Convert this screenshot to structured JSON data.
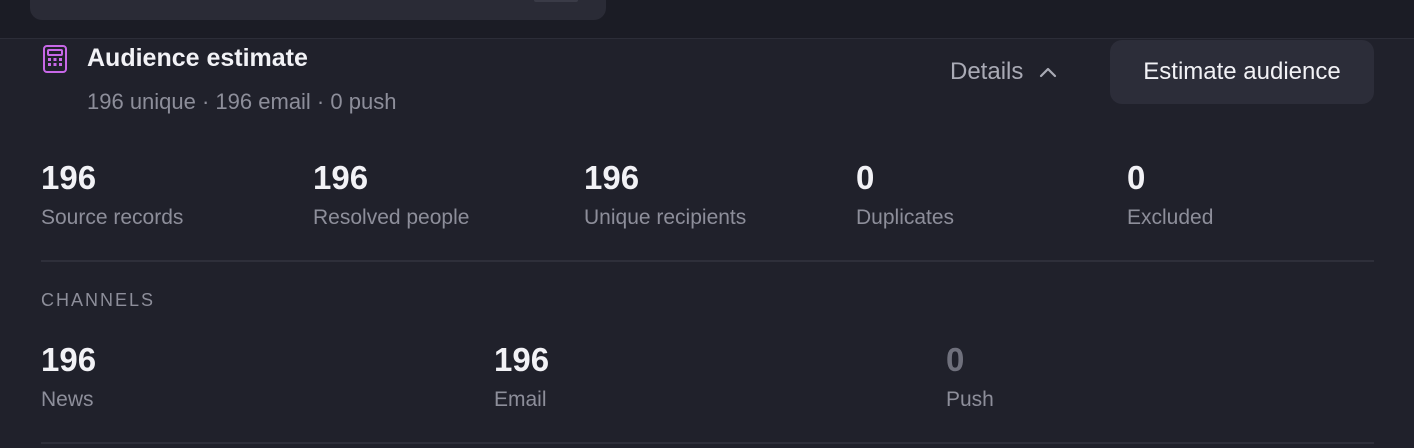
{
  "panel": {
    "title": "Audience estimate",
    "subtitle": "196 unique · 196 email · 0 push",
    "details_label": "Details",
    "estimate_button": "Estimate audience"
  },
  "stats": [
    {
      "value": "196",
      "label": "Source records"
    },
    {
      "value": "196",
      "label": "Resolved people"
    },
    {
      "value": "196",
      "label": "Unique recipients"
    },
    {
      "value": "0",
      "label": "Duplicates"
    },
    {
      "value": "0",
      "label": "Excluded"
    }
  ],
  "channels": {
    "heading": "CHANNELS",
    "items": [
      {
        "value": "196",
        "label": "News"
      },
      {
        "value": "196",
        "label": "Email"
      },
      {
        "value": "0",
        "label": "Push"
      }
    ]
  },
  "colors": {
    "background": "#20212b",
    "accent_icon": "#c868e8",
    "button_bg": "#2c2d39"
  },
  "icons": {
    "panel_icon": "calculator-icon",
    "details_icon": "chevron-up-icon"
  }
}
